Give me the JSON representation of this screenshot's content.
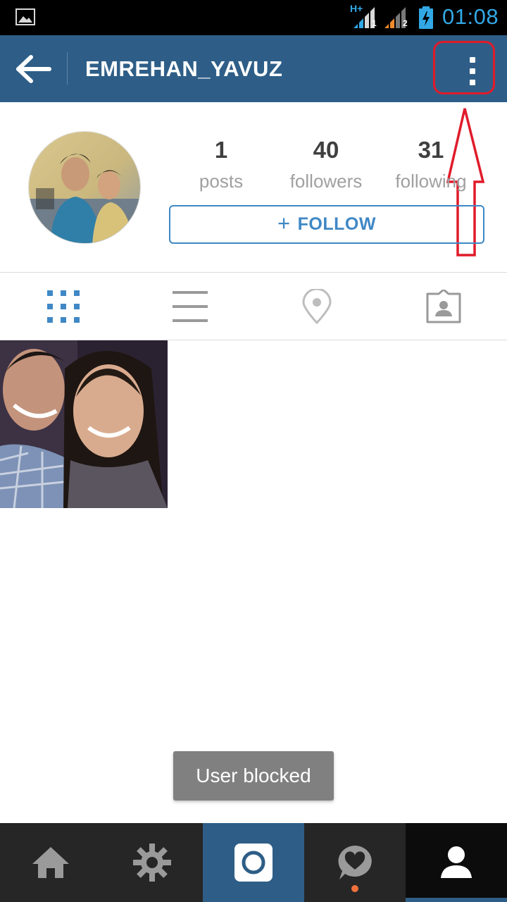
{
  "status_bar": {
    "network_type": "H+",
    "sim1_label": "1",
    "sim2_label": "2",
    "time": "01:08",
    "icons": [
      "gallery-notification-icon",
      "signal-sim1-icon",
      "signal-sim2-icon",
      "battery-charging-icon"
    ]
  },
  "header": {
    "username": "EMREHAN_YAVUZ",
    "back_icon": "arrow-left-icon",
    "menu_icon": "vertical-dots-icon"
  },
  "profile": {
    "avatar_icon": "profile-photo",
    "stats": [
      {
        "value": "1",
        "label": "posts"
      },
      {
        "value": "40",
        "label": "followers"
      },
      {
        "value": "31",
        "label": "following"
      }
    ],
    "follow_button": {
      "plus": "+",
      "label": "FOLLOW"
    }
  },
  "view_tabs": [
    {
      "icon": "grid-icon",
      "active": true
    },
    {
      "icon": "list-icon",
      "active": false
    },
    {
      "icon": "location-pin-icon",
      "active": false
    },
    {
      "icon": "tagged-photos-icon",
      "active": false
    }
  ],
  "posts": [
    {
      "icon": "post-photo"
    }
  ],
  "toast": {
    "message": "User blocked"
  },
  "bottom_nav": [
    {
      "icon": "home-icon",
      "active": false
    },
    {
      "icon": "explore-star-icon",
      "active": false
    },
    {
      "icon": "camera-icon",
      "active": false
    },
    {
      "icon": "activity-heart-icon",
      "active": false,
      "has_notification": true
    },
    {
      "icon": "profile-icon",
      "active": true
    }
  ],
  "colors": {
    "app_bar": "#2e5e87",
    "follow_blue": "#3f88c5",
    "status_time": "#32a8e6",
    "annotation_red": "#e01b2a",
    "notification_dot": "#f0703c"
  }
}
